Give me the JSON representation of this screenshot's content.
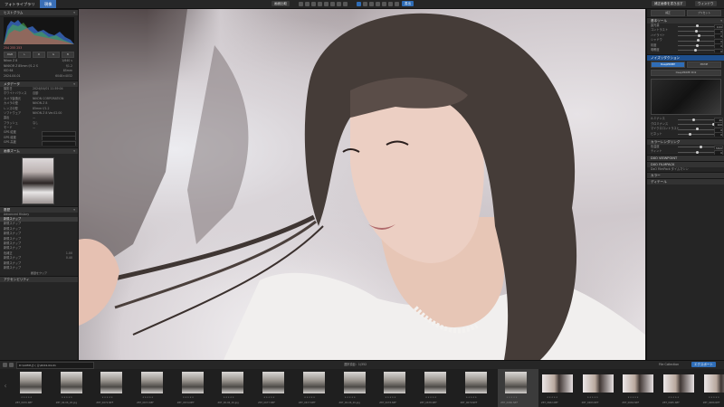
{
  "tabs": [
    "フォトライブラリ",
    "現像"
  ],
  "toolbar": {
    "buttons": [
      "画面比較",
      "補正",
      "編集",
      "ヘルプ"
    ],
    "export_label": "書出",
    "right_buttons": [
      "補正画像を書き出す",
      "ウィンドウ"
    ]
  },
  "left": {
    "histogram_title": "ヒストグラム",
    "histogram_values": "254  255  253",
    "info_rows": [
      {
        "label": "Nikon Z 8",
        "value": "1/640 s"
      },
      {
        "label": "NIKKOR Z 85mm f/1.2 S",
        "value": "f/1.2"
      },
      {
        "label": "ISO 64",
        "value": "85mm"
      },
      {
        "label": "2024-04-01",
        "value": "6048×4032"
      }
    ],
    "metadata_title": "メタデータ",
    "metadata_rows": [
      {
        "label": "撮影日",
        "value": "2024/04/01 11:59:04"
      },
      {
        "label": "ホワイトバランス",
        "value": "自動"
      },
      {
        "label": "カメラ製造元",
        "value": "NIKON CORPORATION"
      },
      {
        "label": "カメラの型",
        "value": "NIKON Z 8"
      },
      {
        "label": "レンズの型",
        "value": "85mm f/1.2"
      },
      {
        "label": "ソフトウェア",
        "value": "NIKON Z 8 Ver.02.00"
      },
      {
        "label": "露出",
        "value": "—"
      },
      {
        "label": "フラッシュ",
        "value": "なし"
      },
      {
        "label": "モード",
        "value": "—"
      }
    ],
    "gps_rows": [
      "GPS 緯度",
      "GPS 経度",
      "GPS 高度"
    ],
    "navigator_title": "画像ズーム",
    "history_title": "履歴",
    "history_rows": [
      "Advanced History",
      "新規スナップ",
      "新規スナップ",
      "新規スナップ",
      "新規スナップ",
      "新規スナップ",
      "新規スナップ",
      "新規スナップ",
      "色補正",
      "新規スナップ",
      "新規スナップ",
      "新規スナップ"
    ],
    "history_values": [
      "",
      "",
      "",
      "",
      "",
      "",
      "",
      "",
      "1.00",
      "0.40",
      "",
      ""
    ],
    "history_button": "履歴をクリア",
    "bottom_section": "アクセシビリティ"
  },
  "right": {
    "header_buttons": [
      "補正",
      "プリセット",
      "キャリブレーション"
    ],
    "sections": [
      "基本ツール",
      "ノイズリダクション",
      "ホワイトバランス",
      "カラーレンダリング",
      "トーン",
      "DXO VIEWPOINT",
      "DXO FILMPACK",
      "カラー",
      "ディテール"
    ],
    "dropdown_values": [
      "DeepPRIME",
      "PRIME",
      "DeepPRIME XD2"
    ],
    "slider_labels": [
      "露光量",
      "コントラスト",
      "ハイライト",
      "シャドウ",
      "彩度",
      "明瞭度",
      "マイクロコントラスト",
      "ビネット",
      "色温度",
      "ティント",
      "ルミナンス",
      "クロミナンス"
    ],
    "slider_values": [
      "0.00",
      "0",
      "0",
      "0",
      "0",
      "0",
      "0",
      "0",
      "5500",
      "0",
      "40",
      "100"
    ],
    "bottom_label": "DxO FilmPack タイムマシン"
  },
  "filmstrip": {
    "folder_path": "D:\\GOMI\\さくら\\2024-04-01",
    "center_label": "選択項目：1/352",
    "right_button": "エクスポート",
    "right_label": "File Collection",
    "thumbnails": [
      {
        "name": "Z8T_0670.NEF",
        "type": "portrait"
      },
      {
        "name": "Z8T_06-06_26.jpg",
        "type": "portrait"
      },
      {
        "name": "Z8T_0672.NEF",
        "type": "portrait"
      },
      {
        "name": "Z8T_0673.NEF",
        "type": "portrait"
      },
      {
        "name": "Z8T_0674.NEF",
        "type": "portrait"
      },
      {
        "name": "Z8T_06-06_26.jpg",
        "type": "portrait"
      },
      {
        "name": "Z8T_0677.NEF",
        "type": "portrait"
      },
      {
        "name": "Z8T_0677.NEF",
        "type": "portrait"
      },
      {
        "name": "Z8T_06-06_26.jpg",
        "type": "portrait"
      },
      {
        "name": "Z8T_0678.NEF",
        "type": "portrait"
      },
      {
        "name": "Z8T_0678.NEF",
        "type": "portrait"
      },
      {
        "name": "Z8T_0679.NEF",
        "type": "portrait"
      },
      {
        "name": "Z8T_0680.NEF",
        "type": "selected"
      },
      {
        "name": "Z8T_0682.NEF",
        "type": "landscape"
      },
      {
        "name": "Z8T_0683.NEF",
        "type": "landscape"
      },
      {
        "name": "Z8T_0684.NEF",
        "type": "landscape"
      },
      {
        "name": "Z8T_0685.NEF",
        "type": "landscape"
      },
      {
        "name": "Z8T_0686.NEF",
        "type": "landscape"
      }
    ]
  },
  "colors": {
    "accent": "#2f6db7",
    "panel": "#252525",
    "section": "#333333"
  },
  "icons": [
    "histogram-icon",
    "info-icon",
    "metadata-icon",
    "star-icon",
    "folder-icon",
    "export-icon"
  ]
}
